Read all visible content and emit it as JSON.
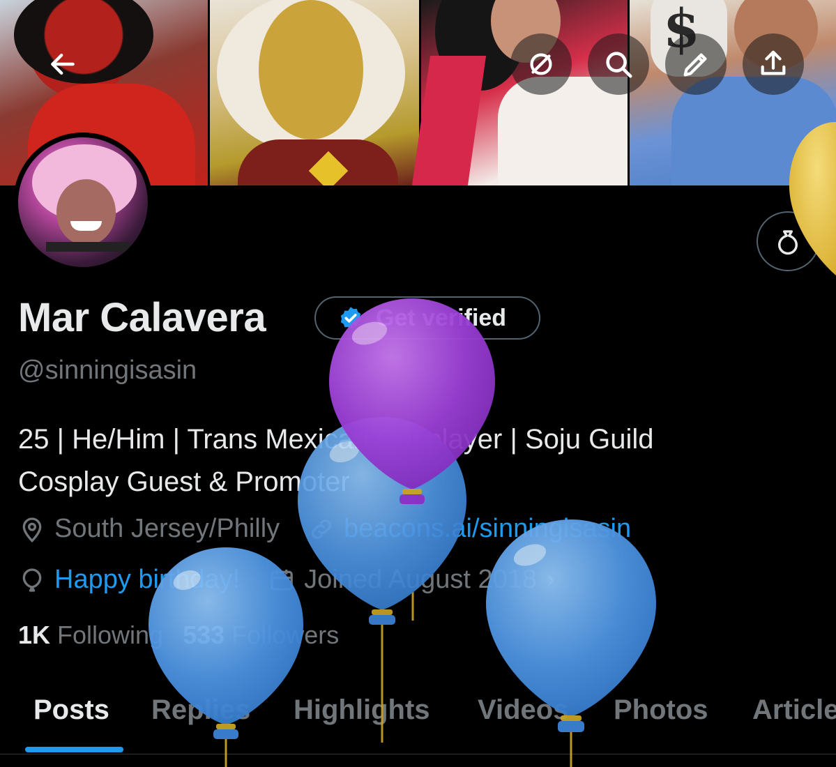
{
  "icons": {
    "back": "back-arrow-icon",
    "grok": "grok-icon",
    "search": "search-icon",
    "edit": "pencil-icon",
    "share": "share-icon",
    "gift": "gift-icon",
    "verified": "verified-badge-icon",
    "location": "location-pin-icon",
    "link": "link-icon",
    "birthday": "balloon-icon",
    "joined": "calendar-icon"
  },
  "profile": {
    "name": "Mar Calavera",
    "handle": "@sinningisasin",
    "bio_line1": "25 | He/Him | Trans Mexican Cosplayer | Soju Guild",
    "bio_line2": "Cosplay Guest & Promoter",
    "location": "South Jersey/Philly",
    "website": "beacons.ai/sinningisasin",
    "birthday": "Happy birthday!",
    "joined": "Joined August 2018",
    "following_count": "1K",
    "following_label": "Following",
    "followers_count": "533",
    "followers_label": "Followers"
  },
  "verify": {
    "label": "Get verified"
  },
  "tabs": [
    {
      "label": "Posts"
    },
    {
      "label": "Replies"
    },
    {
      "label": "Highlights"
    },
    {
      "label": "Videos"
    },
    {
      "label": "Photos"
    },
    {
      "label": "Articles"
    }
  ],
  "colors": {
    "accent": "#1d9bf0",
    "muted": "#71767b",
    "text": "#e7e9ea",
    "balloon_blue": "#4a90e2",
    "balloon_purple": "#9b3fd6",
    "balloon_yellow": "#e6c04a"
  }
}
